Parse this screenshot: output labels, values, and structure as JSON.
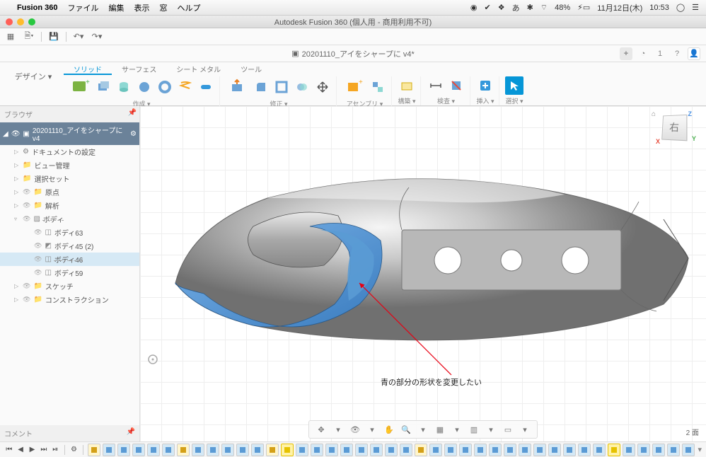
{
  "menubar": {
    "app": "Fusion 360",
    "items": [
      "ファイル",
      "編集",
      "表示",
      "窓",
      "ヘルプ"
    ],
    "battery": "48%",
    "date": "11月12日(木)",
    "time": "10:53"
  },
  "window_title": "Autodesk Fusion 360 (個人用 - 商用利用不可)",
  "tab": {
    "icon": "▣",
    "name": "20201110_アイをシャープに v4*"
  },
  "ribbon": {
    "design_label": "デザイン ▾",
    "tabs": [
      "ソリッド",
      "サーフェス",
      "シート メタル",
      "ツール"
    ],
    "active_tab": 0,
    "groups": [
      {
        "label": "作成 ▾"
      },
      {
        "label": "修正 ▾"
      },
      {
        "label": "アセンブリ ▾"
      },
      {
        "label": "構築 ▾"
      },
      {
        "label": "検査 ▾"
      },
      {
        "label": "挿入 ▾"
      },
      {
        "label": "選択 ▾"
      }
    ]
  },
  "browser": {
    "title": "ブラウザ",
    "root": "20201110_アイをシャープに v4",
    "items": [
      {
        "label": "ドキュメントの設定",
        "depth": 1,
        "arrow": "▷",
        "icon": "gear"
      },
      {
        "label": "ビュー管理",
        "depth": 1,
        "arrow": "▷",
        "icon": "folder"
      },
      {
        "label": "選択セット",
        "depth": 1,
        "arrow": "▷",
        "icon": "folder"
      },
      {
        "label": "原点",
        "depth": 1,
        "arrow": "▷",
        "icon": "folder",
        "eye": true
      },
      {
        "label": "解析",
        "depth": 1,
        "arrow": "▷",
        "icon": "folder",
        "eye": true
      },
      {
        "label": "ボディ",
        "depth": 1,
        "arrow": "▿",
        "icon": "cube",
        "eye": true,
        "hatch": true
      },
      {
        "label": "ボディ63",
        "depth": 2,
        "icon": "body",
        "eye": true
      },
      {
        "label": "ボディ45 (2)",
        "depth": 2,
        "icon": "surf",
        "eye": true
      },
      {
        "label": "ボディ46",
        "depth": 2,
        "icon": "body",
        "eye": true,
        "selected": true,
        "hatch": true
      },
      {
        "label": "ボディ59",
        "depth": 2,
        "icon": "body",
        "eye": true
      },
      {
        "label": "スケッチ",
        "depth": 1,
        "arrow": "▷",
        "icon": "folder",
        "eye": true
      },
      {
        "label": "コンストラクション",
        "depth": 1,
        "arrow": "▷",
        "icon": "folder",
        "eye": true
      }
    ],
    "comment_title": "コメント"
  },
  "canvas": {
    "viewcube_face": "右",
    "annotation": "青の部分の形状を変更したい",
    "footer_count": "2 面"
  },
  "timeline": {
    "playback": [
      "⏮",
      "◀",
      "▶",
      "⏭",
      "⏯"
    ]
  }
}
